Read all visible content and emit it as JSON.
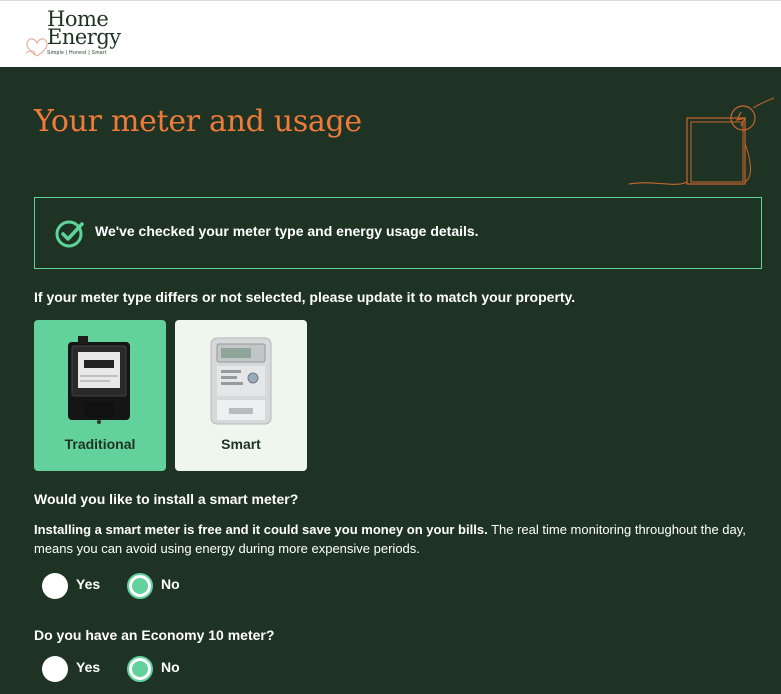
{
  "brand": {
    "name_line1": "Home",
    "name_line2": "Energy",
    "tagline": "Simple | Honest | Smart"
  },
  "page": {
    "title": "Your meter and usage"
  },
  "notice": {
    "text": "We've checked your meter type and energy usage details.",
    "icon": "check-circle-icon",
    "border_color": "#5ed39a"
  },
  "meter": {
    "prompt": "If your meter type differs or not selected, please update it to match your property.",
    "options": [
      {
        "label": "Traditional",
        "selected": true
      },
      {
        "label": "Smart",
        "selected": false
      }
    ]
  },
  "smart_meter_question": {
    "title": "Would you like to install a smart meter?",
    "desc_bold": "Installing a smart meter is free and it could save you money on your bills.",
    "desc_rest": " The real time monitoring throughout the day, means you can avoid using energy during more expensive periods.",
    "options": [
      {
        "label": "Yes",
        "selected": false
      },
      {
        "label": "No",
        "selected": true
      }
    ]
  },
  "economy_question": {
    "title": "Do you have an Economy 10 meter?",
    "options": [
      {
        "label": "Yes",
        "selected": false
      },
      {
        "label": "No",
        "selected": true
      }
    ]
  },
  "colors": {
    "background": "#1f3324",
    "accent_orange": "#ef7a3a",
    "accent_green": "#62d19b",
    "card_light": "#eef6ee"
  }
}
